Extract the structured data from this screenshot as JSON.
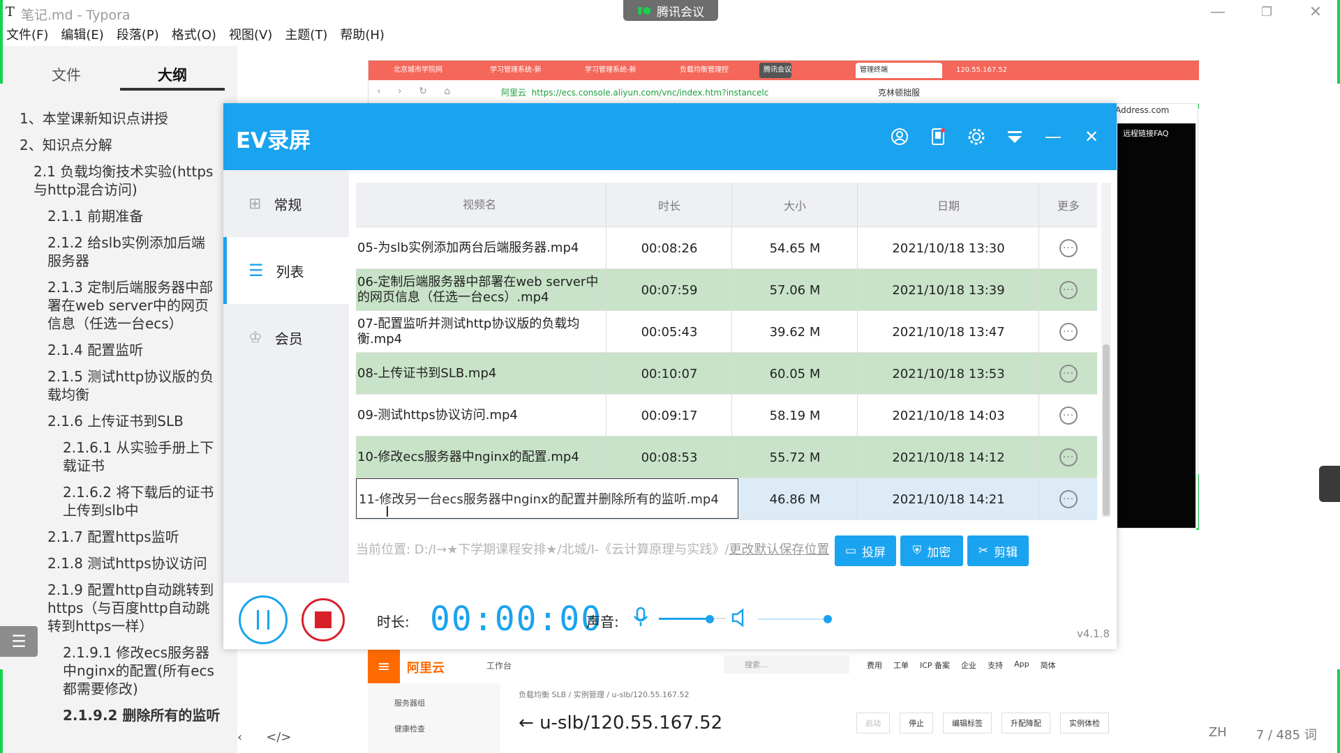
{
  "typora": {
    "logo": "T",
    "title": "笔记.md - Typora",
    "menu": [
      "文件(F)",
      "编辑(E)",
      "段落(P)",
      "格式(O)",
      "视图(V)",
      "主题(T)",
      "帮助(H)"
    ],
    "tabs": {
      "files": "文件",
      "outline": "大纲"
    },
    "outline": [
      "1、本堂课新知识点讲授",
      "2、知识点分解",
      "2.1 负载均衡技术实验(https与http混合访问)",
      "2.1.1 前期准备",
      "2.1.2 给slb实例添加后端服务器",
      "2.1.3 定制后端服务器中部署在web server中的网页信息（任选一台ecs）",
      "2.1.4 配置监听",
      "2.1.5 测试http协议版的负载均衡",
      "2.1.6 上传证书到SLB",
      "2.1.6.1 从实验手册上下载证书",
      "2.1.6.2 将下载后的证书上传到slb中",
      "2.1.7 配置https监听",
      "2.1.8 测试https协议访问",
      "2.1.9 配置http自动跳转到https（与百度http自动跳转到https一样）",
      "2.1.9.1 修改ecs服务器中nginx的配置(所有ecs都需要修改)",
      "2.1.9.2 删除所有的监听"
    ],
    "status": {
      "lang": "ZH",
      "words": "7 / 485 词"
    }
  },
  "meeting": {
    "label": "腾讯会议"
  },
  "browser": {
    "tabs": [
      "北京城市学院网",
      "学习管理系统-新",
      "学习管理系统-新",
      "负载均衡管理控",
      "腾讯会议",
      "管理终端",
      "120.55.167.52"
    ],
    "url_prefix": "阿里云",
    "url": "https://ecs.console.aliyun.com/vnc/index.htm?instancelc",
    "search_engine": "克林顿拙服",
    "side_address": "Address.com",
    "faq": "远程链接FAQ"
  },
  "aliyun": {
    "logo": "阿里云",
    "workbench": "工作台",
    "search_placeholder": "搜索...",
    "nav": [
      "费用",
      "工单",
      "ICP 备案",
      "企业",
      "支持",
      "App",
      "简体"
    ],
    "breadcrumb": "负载均衡 SLB / 实例管理 / u-slb/120.55.167.52",
    "side": [
      "服务器组",
      "健康检查"
    ],
    "page_title": "u-slb/120.55.167.52",
    "buttons": [
      "启动",
      "停止",
      "编辑标签",
      "升配降配",
      "实例体检"
    ]
  },
  "ev": {
    "title": "EV录屏",
    "nav": [
      {
        "label": "常规",
        "icon": "grid-icon"
      },
      {
        "label": "列表",
        "icon": "list-icon"
      },
      {
        "label": "会员",
        "icon": "crown-icon"
      }
    ],
    "columns": [
      "视频名",
      "时长",
      "大小",
      "日期",
      "更多"
    ],
    "rows": [
      {
        "name": "05-为slb实例添加两台后端服务器.mp4",
        "duration": "00:08:26",
        "size": "54.65 M",
        "date": "2021/10/18 13:30",
        "style": "white"
      },
      {
        "name": "06-定制后端服务器中部署在web server中的网页信息（任选一台ecs）.mp4",
        "duration": "00:07:59",
        "size": "57.06 M",
        "date": "2021/10/18 13:39",
        "style": "green"
      },
      {
        "name": "07-配置监听并测试http协议版的负载均衡.mp4",
        "duration": "00:05:43",
        "size": "39.62 M",
        "date": "2021/10/18 13:47",
        "style": "white"
      },
      {
        "name": "08-上传证书到SLB.mp4",
        "duration": "00:10:07",
        "size": "60.05 M",
        "date": "2021/10/18 13:53",
        "style": "green"
      },
      {
        "name": "09-测试https协议访问.mp4",
        "duration": "00:09:17",
        "size": "58.19 M",
        "date": "2021/10/18 14:03",
        "style": "white"
      },
      {
        "name": "10-修改ecs服务器中nginx的配置.mp4",
        "duration": "00:08:53",
        "size": "55.72 M",
        "date": "2021/10/18 14:12",
        "style": "green"
      },
      {
        "name": "11-修改另一台ecs服务器中nginx的配置并删除所有的监听.mp4",
        "duration": "",
        "size": "46.86 M",
        "date": "2021/10/18 14:21",
        "style": "selected"
      }
    ],
    "save_path": "当前位置: D:/Ⅰ→★下学期课程安排★/北城/Ⅰ-《云计算原理与实践》/",
    "save_path_link": "更改默认保存位置",
    "actions": [
      "投屏",
      "加密",
      "剪辑"
    ],
    "duration_label": "时长:",
    "timer": "00:00:00",
    "sound_label": "声音:",
    "version": "v4.1.8",
    "mic_level": 0.8,
    "speaker_level": 1.0
  },
  "colors": {
    "ev_blue": "#1aa3ef",
    "row_green": "#c8e3c8",
    "share_green": "#19d14e",
    "stop_red": "#d8202a",
    "browser_tab_red": "#f4675a"
  }
}
